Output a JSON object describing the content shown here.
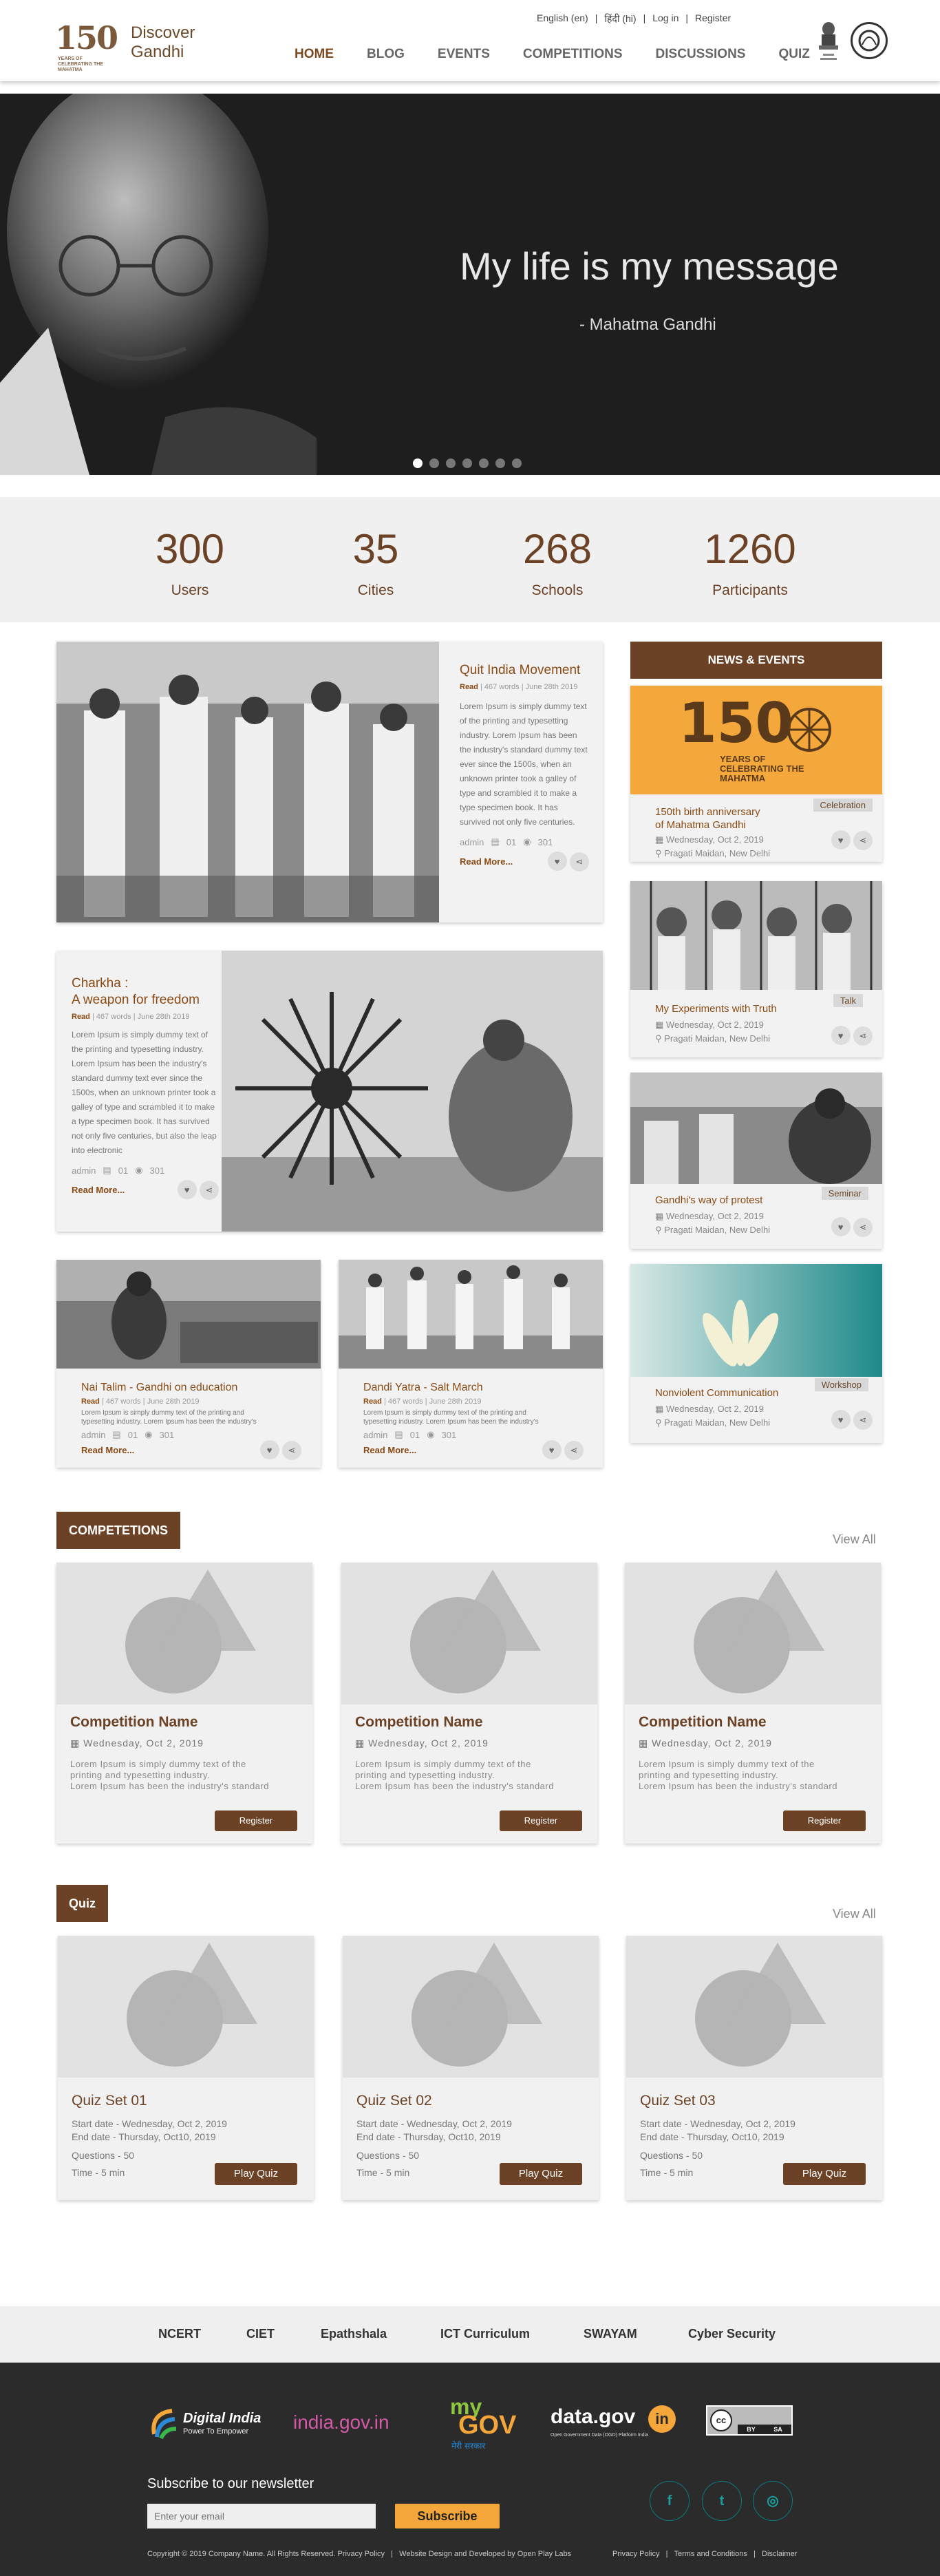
{
  "header": {
    "logo_number": "150",
    "logo_subtext": "YEARS OF CELEBRATING THE MAHATMA",
    "logo_title_line1": "Discover",
    "logo_title_line2": "Gandhi",
    "top_links": [
      "English (en)",
      "|",
      "हिंदी (hi)",
      "|",
      "Log in",
      "|",
      "Register"
    ],
    "nav": [
      "HOME",
      "BLOG",
      "EVENTS",
      "COMPETITIONS",
      "DISCUSSIONS",
      "QUIZ"
    ]
  },
  "hero": {
    "quote": "My life is my message",
    "author": "- Mahatma Gandhi",
    "slide_count": 7,
    "active_slide": 1
  },
  "stats": [
    {
      "value": "300",
      "label": "Users"
    },
    {
      "value": "35",
      "label": "Cities"
    },
    {
      "value": "268",
      "label": "Schools"
    },
    {
      "value": "1260",
      "label": "Participants"
    }
  ],
  "articles": {
    "quit_india": {
      "title": "Quit India Movement",
      "read": "Read",
      "meta": "| 467 words | June 28th 2019",
      "body": "Lorem Ipsum is simply dummy text of the printing and typesetting industry. Lorem Ipsum has been the industry's standard dummy text ever since the 1500s, when an unknown printer took a galley of type and scrambled it to make a type specimen book. It has survived not only five centuries.",
      "author": "admin",
      "comments": "01",
      "views": "301",
      "read_more": "Read More..."
    },
    "charkha": {
      "title_line1": "Charkha :",
      "title_line2": "A weapon for freedom",
      "read": "Read",
      "meta": "| 467 words | June 28th 2019",
      "body": "Lorem Ipsum is simply dummy text of the printing and typesetting industry. Lorem Ipsum has been the industry's standard dummy text ever since the 1500s, when an unknown printer took a galley of type and scrambled it to make a type specimen book. It has survived not only five centuries, but also the leap into electronic",
      "author": "admin",
      "comments": "01",
      "views": "301",
      "read_more": "Read More..."
    },
    "nai_talim": {
      "title": "Nai Talim - Gandhi on education",
      "read": "Read",
      "meta": "| 467 words | June 28th 2019",
      "body": "Lorem Ipsum is simply dummy text of the printing and typesetting industry. Lorem Ipsum has been the industry's",
      "author": "admin",
      "comments": "01",
      "views": "301",
      "read_more": "Read More..."
    },
    "dandi": {
      "title": "Dandi Yatra - Salt March",
      "read": "Read",
      "meta": "| 467 words | June 28th 2019",
      "body": "Lorem Ipsum is simply dummy text of the printing and typesetting industry. Lorem Ipsum has been the industry's",
      "author": "admin",
      "comments": "01",
      "views": "301",
      "read_more": "Read More..."
    }
  },
  "news": {
    "heading": "NEWS & EVENTS",
    "banner_number": "150",
    "banner_text": "YEARS OF CELEBRATING THE MAHATMA",
    "events": [
      {
        "title_line1": "150th birth anniversary",
        "title_line2": "of Mahatma Gandhi",
        "tag": "Celebration",
        "date": "Wednesday, Oct 2, 2019",
        "location": "Pragati Maidan, New Delhi"
      },
      {
        "title_line1": "My Experiments with Truth",
        "title_line2": "",
        "tag": "Talk",
        "date": "Wednesday, Oct 2, 2019",
        "location": "Pragati Maidan, New Delhi"
      },
      {
        "title_line1": "Gandhi's way of protest",
        "title_line2": "",
        "tag": "Seminar",
        "date": "Wednesday, Oct 2, 2019",
        "location": "Pragati Maidan, New Delhi"
      },
      {
        "title_line1": "Nonviolent Communication",
        "title_line2": "",
        "tag": "Workshop",
        "date": "Wednesday, Oct 2, 2019",
        "location": "Pragati Maidan, New Delhi"
      }
    ]
  },
  "competitions": {
    "label": "COMPETETIONS",
    "view_all": "View All",
    "items": [
      {
        "title": "Competition Name",
        "date": "Wednesday, Oct 2, 2019",
        "desc1": "Lorem Ipsum is simply dummy text of the",
        "desc2": "printing and typesetting industry.",
        "desc3": "Lorem Ipsum has been the industry's standard",
        "button": "Register"
      },
      {
        "title": "Competition Name",
        "date": "Wednesday, Oct 2, 2019",
        "desc1": "Lorem Ipsum is simply dummy text of the",
        "desc2": "printing and typesetting industry.",
        "desc3": "Lorem Ipsum has been the industry's standard",
        "button": "Register"
      },
      {
        "title": "Competition Name",
        "date": "Wednesday, Oct 2, 2019",
        "desc1": "Lorem Ipsum is simply dummy text of the",
        "desc2": "printing and typesetting industry.",
        "desc3": "Lorem Ipsum has been the industry's standard",
        "button": "Register"
      }
    ]
  },
  "quiz": {
    "label": "Quiz",
    "view_all": "View All",
    "items": [
      {
        "title": "Quiz Set 01",
        "start": "Start date - Wednesday, Oct 2, 2019",
        "end": "End date - Thursday, Oct10, 2019",
        "questions": "Questions - 50",
        "time": "Time - 5 min",
        "button": "Play Quiz"
      },
      {
        "title": "Quiz Set 02",
        "start": "Start date - Wednesday, Oct 2, 2019",
        "end": "End date - Thursday, Oct10, 2019",
        "questions": "Questions - 50",
        "time": "Time - 5 min",
        "button": "Play Quiz"
      },
      {
        "title": "Quiz Set 03",
        "start": "Start date - Wednesday, Oct 2, 2019",
        "end": "End date - Thursday, Oct10, 2019",
        "questions": "Questions - 50",
        "time": "Time - 5 min",
        "button": "Play Quiz"
      }
    ]
  },
  "footer_links": [
    "NCERT",
    "CIET",
    "Epathshala",
    "ICT Curriculum",
    "SWAYAM",
    "Cyber Security"
  ],
  "footer": {
    "partners": {
      "digital_india": "Digital India",
      "digital_india_sub": "Power To Empower",
      "india_gov": "india.gov.in",
      "mygov_my": "my",
      "mygov_gov": "GOV",
      "mygov_sub": "मेरी सरकार",
      "data_gov": "data.gov",
      "data_gov_in": "in",
      "data_gov_sub": "Open Government Data (OGD) Platform India",
      "cc_by": "BY",
      "cc_sa": "SA"
    },
    "newsletter_label": "Subscribe to our newsletter",
    "email_placeholder": "Enter your email",
    "subscribe": "Subscribe",
    "social": [
      "f",
      "t",
      "◎"
    ],
    "copyright": "Copyright © 2019 Company Name. All Rights Reserved. Privacy Policy   |   Website Design and Developed by Open Play Labs",
    "policy_links": "Privacy Policy   |   Terms and Conditions   |   Disclaimer"
  }
}
